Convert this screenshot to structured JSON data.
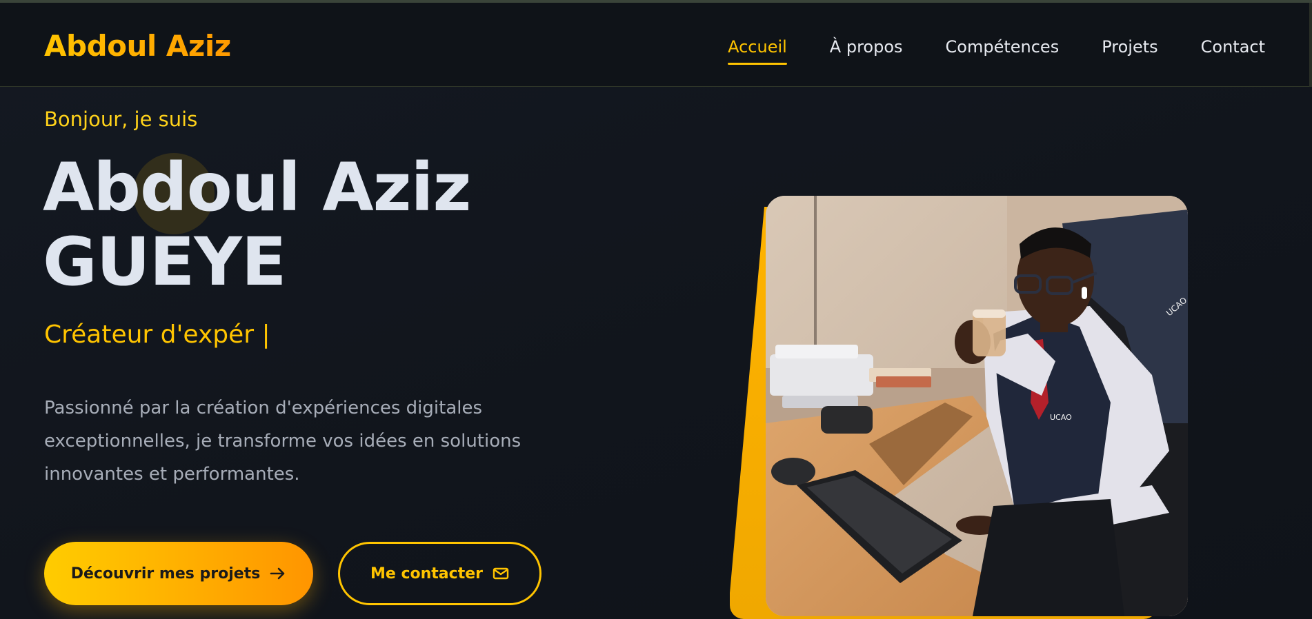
{
  "brand": {
    "name": "Abdoul Aziz"
  },
  "nav": {
    "items": [
      {
        "label": "Accueil",
        "active": true
      },
      {
        "label": "À propos",
        "active": false
      },
      {
        "label": "Compétences",
        "active": false
      },
      {
        "label": "Projets",
        "active": false
      },
      {
        "label": "Contact",
        "active": false
      }
    ]
  },
  "hero": {
    "greeting": "Bonjour, je suis",
    "name_line1": "Abdoul Aziz",
    "name_line2": "GUEYE",
    "typed_text": "Créateur d'expér |",
    "description": "Passionné par la création d'expériences digitales exceptionnelles, je transforme vos idées en solutions innovantes et performantes.",
    "primary_button": "Découvrir mes projets",
    "primary_icon": "arrow-right-icon",
    "secondary_button": "Me contacter",
    "secondary_icon": "envelope-icon",
    "photo_text_vest": "UCAO",
    "photo_text_jacket": "UCAO"
  },
  "colors": {
    "accent": "#ffc400",
    "accent_orange": "#ff9500",
    "background": "#12161e",
    "heading": "#dfe5ef",
    "body_text": "#a7adb8"
  }
}
